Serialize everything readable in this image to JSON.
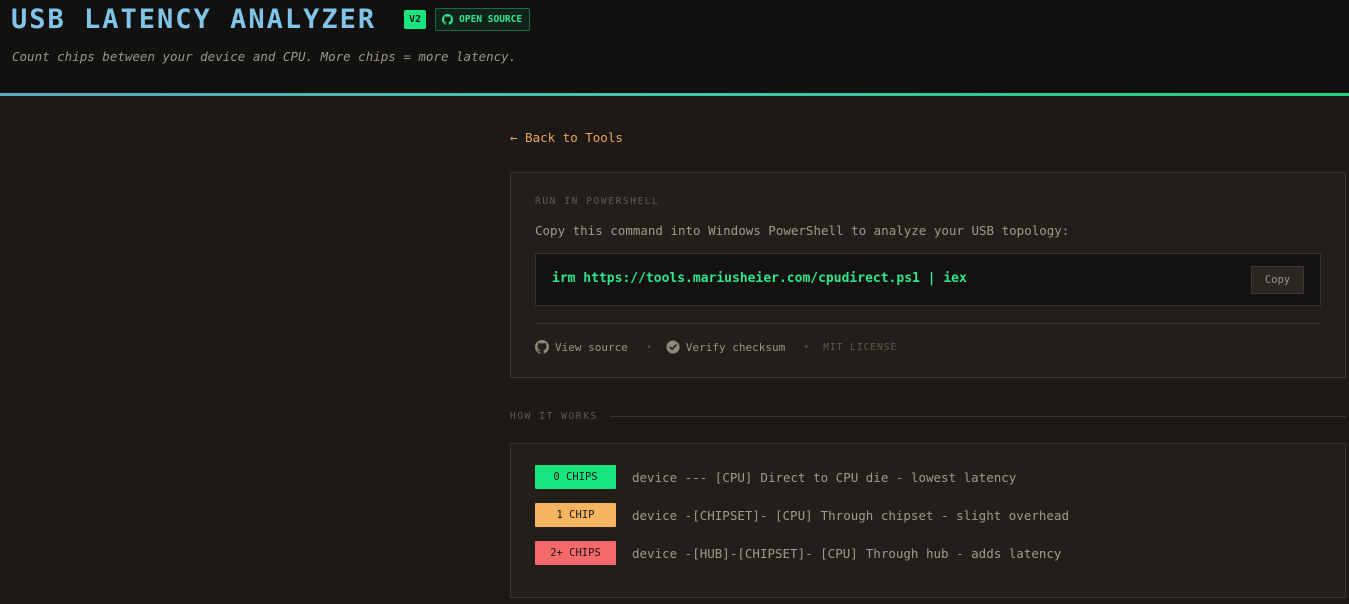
{
  "header": {
    "title": "USB LATENCY ANALYZER",
    "version_badge": "V2",
    "open_source_badge": "OPEN SOURCE",
    "subtitle": "Count chips between your device and CPU. More chips = more latency."
  },
  "nav": {
    "back_link": "← Back to Tools"
  },
  "run_card": {
    "section_label": "RUN IN POWERSHELL",
    "description": "Copy this command into Windows PowerShell to analyze your USB topology:",
    "command": "irm https://tools.mariusheier.com/cpudirect.ps1 | iex",
    "copy_label": "Copy",
    "view_source_label": "View source",
    "verify_checksum_label": "Verify checksum",
    "license_label": "MIT LICENSE",
    "separator": "•"
  },
  "how_it_works": {
    "section_label": "HOW IT WORKS",
    "rows": [
      {
        "chip": "0 CHIPS",
        "diagram": "device --- [CPU]",
        "note": "Direct to CPU die - lowest latency",
        "color": "#17e680"
      },
      {
        "chip": "1 CHIP",
        "diagram": "device -[CHIPSET]- [CPU]",
        "note": "Through chipset - slight overhead",
        "color": "#f5b460"
      },
      {
        "chip": "2+ CHIPS",
        "diagram": "device -[HUB]-[CHIPSET]- [CPU]",
        "note": "Through hub - adds latency",
        "color": "#f46a6a"
      }
    ]
  },
  "icons": {
    "github": "github-icon",
    "check": "check-circle-icon"
  },
  "colors": {
    "accent_blue": "#82c3e8",
    "accent_green": "#17e680",
    "link_orange": "#e9a55a"
  }
}
